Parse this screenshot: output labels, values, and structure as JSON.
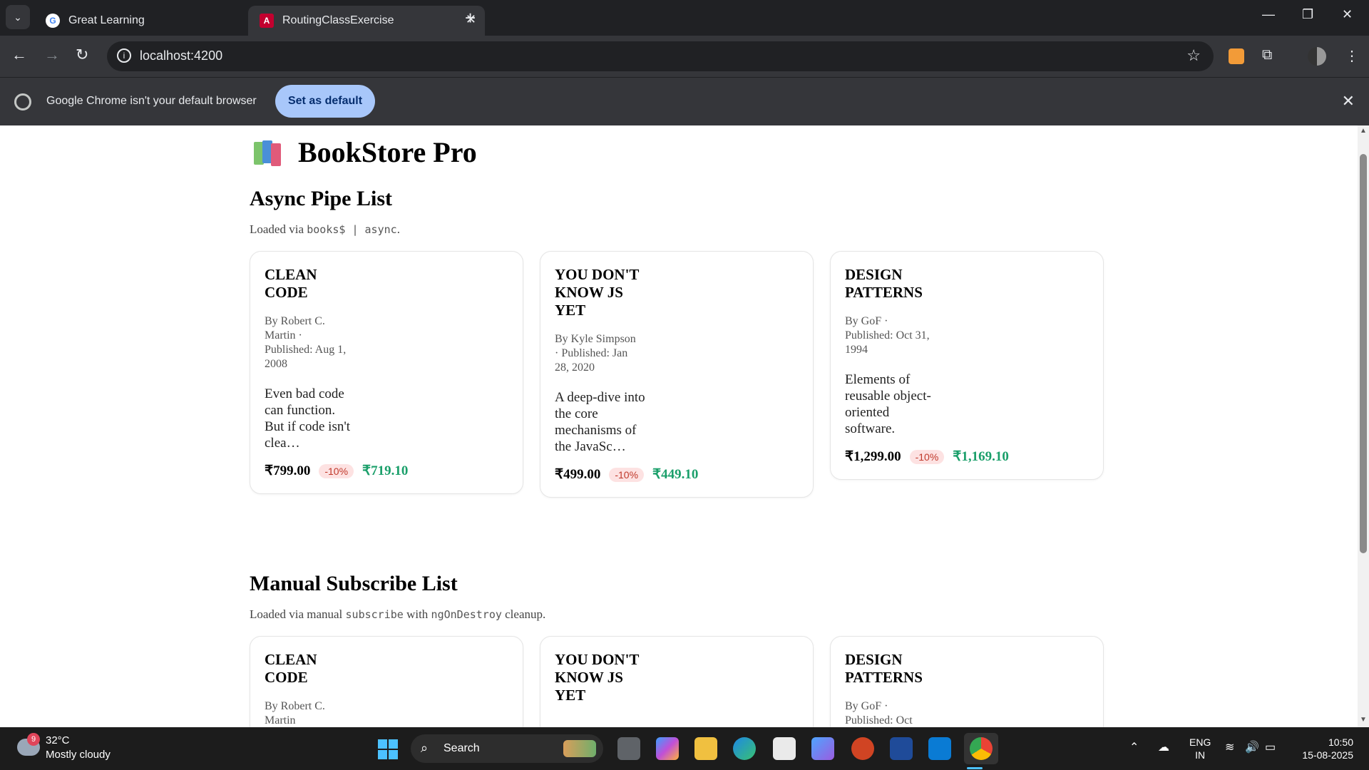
{
  "browser": {
    "tabs": [
      {
        "title": "Great Learning",
        "active": false,
        "favicon": "google-g-icon"
      },
      {
        "title": "RoutingClassExercise",
        "active": true,
        "favicon": "angular-icon"
      }
    ],
    "url": "localhost:4200",
    "infobar": {
      "message": "Google Chrome isn't your default browser",
      "button": "Set as default"
    }
  },
  "page": {
    "title": "BookStore Pro",
    "sections": [
      {
        "title": "Async Pipe List",
        "sub_prefix": "Loaded via ",
        "sub_code1": "books$ | async",
        "sub_mid": ".",
        "books": [
          {
            "title": "CLEAN CODE",
            "meta": "By Robert C. Martin · Published: Aug 1, 2008",
            "desc": "Even bad code can function. But if code isn't clea…",
            "price": "₹799.00",
            "discount": "-10%",
            "final": "₹719.10"
          },
          {
            "title": "YOU DON'T KNOW JS YET",
            "meta": "By Kyle Simpson · Published: Jan 28, 2020",
            "desc": "A deep-dive into the core mechanisms of the JavaSc…",
            "price": "₹499.00",
            "discount": "-10%",
            "final": "₹449.10"
          },
          {
            "title": "DESIGN PATTERNS",
            "meta": "By GoF · Published: Oct 31, 1994",
            "desc": "Elements of reusable object-oriented software.",
            "price": "₹1,299.00",
            "discount": "-10%",
            "final": "₹1,169.10"
          }
        ]
      },
      {
        "title": "Manual Subscribe List",
        "sub_prefix": "Loaded via manual ",
        "sub_code1": "subscribe",
        "sub_mid": " with ",
        "sub_code2": "ngOnDestroy",
        "sub_suffix": " cleanup.",
        "books": [
          {
            "title": "CLEAN CODE",
            "meta": "By Robert C. Martin"
          },
          {
            "title": "YOU DON'T KNOW JS YET",
            "meta": ""
          },
          {
            "title": "DESIGN PATTERNS",
            "meta": "By GoF · Published: Oct"
          }
        ]
      }
    ]
  },
  "taskbar": {
    "weather_temp": "32°C",
    "weather_desc": "Mostly cloudy",
    "weather_badge": "9",
    "search_label": "Search",
    "lang_line1": "ENG",
    "lang_line2": "IN",
    "time": "10:50",
    "date": "15-08-2025"
  },
  "colors": {
    "accent_green": "#1a9f6a",
    "discount_red": "#c0392b",
    "set_default_blue": "#a8c7fa"
  }
}
